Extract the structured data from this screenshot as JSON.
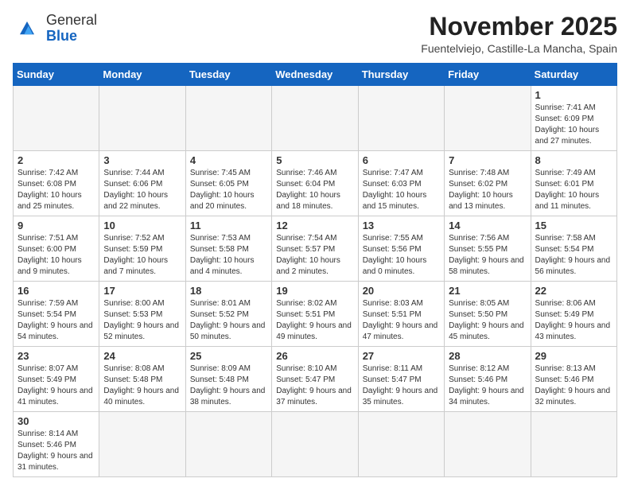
{
  "header": {
    "logo_line1": "General",
    "logo_line2": "Blue",
    "title": "November 2025",
    "subtitle": "Fuentelviejo, Castille-La Mancha, Spain"
  },
  "weekdays": [
    "Sunday",
    "Monday",
    "Tuesday",
    "Wednesday",
    "Thursday",
    "Friday",
    "Saturday"
  ],
  "weeks": [
    [
      {
        "day": "",
        "info": ""
      },
      {
        "day": "",
        "info": ""
      },
      {
        "day": "",
        "info": ""
      },
      {
        "day": "",
        "info": ""
      },
      {
        "day": "",
        "info": ""
      },
      {
        "day": "",
        "info": ""
      },
      {
        "day": "1",
        "info": "Sunrise: 7:41 AM\nSunset: 6:09 PM\nDaylight: 10 hours and 27 minutes."
      }
    ],
    [
      {
        "day": "2",
        "info": "Sunrise: 7:42 AM\nSunset: 6:08 PM\nDaylight: 10 hours and 25 minutes."
      },
      {
        "day": "3",
        "info": "Sunrise: 7:44 AM\nSunset: 6:06 PM\nDaylight: 10 hours and 22 minutes."
      },
      {
        "day": "4",
        "info": "Sunrise: 7:45 AM\nSunset: 6:05 PM\nDaylight: 10 hours and 20 minutes."
      },
      {
        "day": "5",
        "info": "Sunrise: 7:46 AM\nSunset: 6:04 PM\nDaylight: 10 hours and 18 minutes."
      },
      {
        "day": "6",
        "info": "Sunrise: 7:47 AM\nSunset: 6:03 PM\nDaylight: 10 hours and 15 minutes."
      },
      {
        "day": "7",
        "info": "Sunrise: 7:48 AM\nSunset: 6:02 PM\nDaylight: 10 hours and 13 minutes."
      },
      {
        "day": "8",
        "info": "Sunrise: 7:49 AM\nSunset: 6:01 PM\nDaylight: 10 hours and 11 minutes."
      }
    ],
    [
      {
        "day": "9",
        "info": "Sunrise: 7:51 AM\nSunset: 6:00 PM\nDaylight: 10 hours and 9 minutes."
      },
      {
        "day": "10",
        "info": "Sunrise: 7:52 AM\nSunset: 5:59 PM\nDaylight: 10 hours and 7 minutes."
      },
      {
        "day": "11",
        "info": "Sunrise: 7:53 AM\nSunset: 5:58 PM\nDaylight: 10 hours and 4 minutes."
      },
      {
        "day": "12",
        "info": "Sunrise: 7:54 AM\nSunset: 5:57 PM\nDaylight: 10 hours and 2 minutes."
      },
      {
        "day": "13",
        "info": "Sunrise: 7:55 AM\nSunset: 5:56 PM\nDaylight: 10 hours and 0 minutes."
      },
      {
        "day": "14",
        "info": "Sunrise: 7:56 AM\nSunset: 5:55 PM\nDaylight: 9 hours and 58 minutes."
      },
      {
        "day": "15",
        "info": "Sunrise: 7:58 AM\nSunset: 5:54 PM\nDaylight: 9 hours and 56 minutes."
      }
    ],
    [
      {
        "day": "16",
        "info": "Sunrise: 7:59 AM\nSunset: 5:54 PM\nDaylight: 9 hours and 54 minutes."
      },
      {
        "day": "17",
        "info": "Sunrise: 8:00 AM\nSunset: 5:53 PM\nDaylight: 9 hours and 52 minutes."
      },
      {
        "day": "18",
        "info": "Sunrise: 8:01 AM\nSunset: 5:52 PM\nDaylight: 9 hours and 50 minutes."
      },
      {
        "day": "19",
        "info": "Sunrise: 8:02 AM\nSunset: 5:51 PM\nDaylight: 9 hours and 49 minutes."
      },
      {
        "day": "20",
        "info": "Sunrise: 8:03 AM\nSunset: 5:51 PM\nDaylight: 9 hours and 47 minutes."
      },
      {
        "day": "21",
        "info": "Sunrise: 8:05 AM\nSunset: 5:50 PM\nDaylight: 9 hours and 45 minutes."
      },
      {
        "day": "22",
        "info": "Sunrise: 8:06 AM\nSunset: 5:49 PM\nDaylight: 9 hours and 43 minutes."
      }
    ],
    [
      {
        "day": "23",
        "info": "Sunrise: 8:07 AM\nSunset: 5:49 PM\nDaylight: 9 hours and 41 minutes."
      },
      {
        "day": "24",
        "info": "Sunrise: 8:08 AM\nSunset: 5:48 PM\nDaylight: 9 hours and 40 minutes."
      },
      {
        "day": "25",
        "info": "Sunrise: 8:09 AM\nSunset: 5:48 PM\nDaylight: 9 hours and 38 minutes."
      },
      {
        "day": "26",
        "info": "Sunrise: 8:10 AM\nSunset: 5:47 PM\nDaylight: 9 hours and 37 minutes."
      },
      {
        "day": "27",
        "info": "Sunrise: 8:11 AM\nSunset: 5:47 PM\nDaylight: 9 hours and 35 minutes."
      },
      {
        "day": "28",
        "info": "Sunrise: 8:12 AM\nSunset: 5:46 PM\nDaylight: 9 hours and 34 minutes."
      },
      {
        "day": "29",
        "info": "Sunrise: 8:13 AM\nSunset: 5:46 PM\nDaylight: 9 hours and 32 minutes."
      }
    ],
    [
      {
        "day": "30",
        "info": "Sunrise: 8:14 AM\nSunset: 5:46 PM\nDaylight: 9 hours and 31 minutes."
      },
      {
        "day": "",
        "info": ""
      },
      {
        "day": "",
        "info": ""
      },
      {
        "day": "",
        "info": ""
      },
      {
        "day": "",
        "info": ""
      },
      {
        "day": "",
        "info": ""
      },
      {
        "day": "",
        "info": ""
      }
    ]
  ]
}
